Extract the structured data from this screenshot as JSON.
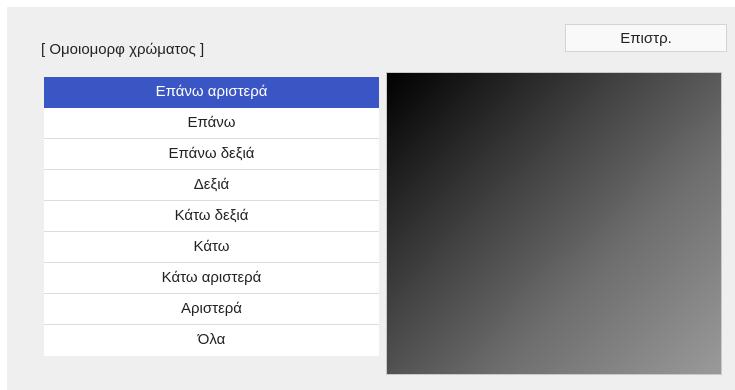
{
  "header": {
    "title": "[ Ομοιομορφ χρώματος ]",
    "back_label": "Επιστρ."
  },
  "menu": {
    "selected_index": 0,
    "items": [
      {
        "label": "Επάνω αριστερά"
      },
      {
        "label": "Επάνω"
      },
      {
        "label": "Επάνω δεξιά"
      },
      {
        "label": "Δεξιά"
      },
      {
        "label": "Κάτω δεξιά"
      },
      {
        "label": "Κάτω"
      },
      {
        "label": "Κάτω αριστερά"
      },
      {
        "label": "Αριστερά"
      },
      {
        "label": "Όλα"
      }
    ]
  },
  "colors": {
    "selected_bg": "#3a55c4",
    "panel_bg": "#efefef"
  }
}
